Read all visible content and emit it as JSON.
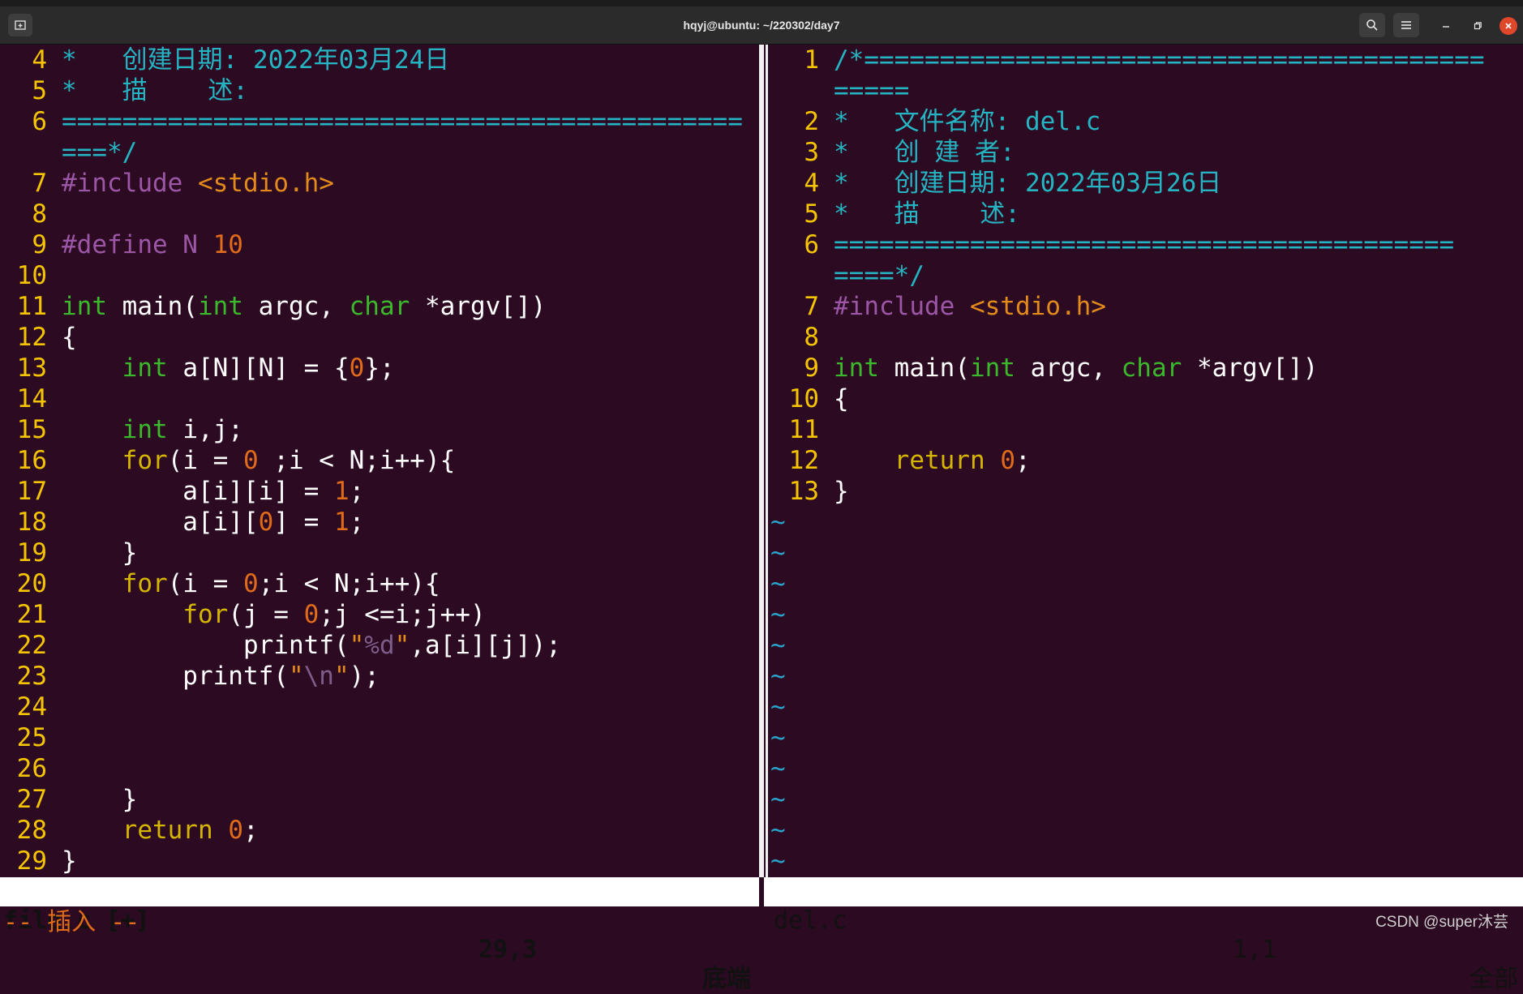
{
  "window": {
    "title": "hqyj@ubuntu: ~/220302/day7",
    "new_tab_icon": "new-tab-icon",
    "search_icon": "search-icon",
    "menu_icon": "hamburger-menu-icon",
    "minimize_icon": "minimize-icon",
    "maximize_icon": "maximize-icon",
    "close_icon": "close-icon"
  },
  "left_pane": {
    "lines": [
      {
        "n": "4",
        "segs": [
          {
            "t": "*   创建日期: 2022年03月24日",
            "c": "cmt"
          }
        ]
      },
      {
        "n": "5",
        "segs": [
          {
            "t": "*   描    述:",
            "c": "cmt"
          }
        ]
      },
      {
        "n": "6",
        "segs": [
          {
            "t": "=============================================",
            "c": "cmt"
          }
        ]
      },
      {
        "n": "",
        "segs": [
          {
            "t": "===*/",
            "c": "cmt"
          }
        ]
      },
      {
        "n": "7",
        "segs": [
          {
            "t": "#include ",
            "c": "pre"
          },
          {
            "t": "<stdio.h>",
            "c": "str"
          }
        ]
      },
      {
        "n": "8",
        "segs": []
      },
      {
        "n": "9",
        "segs": [
          {
            "t": "#define N ",
            "c": "pre"
          },
          {
            "t": "10",
            "c": "num"
          }
        ]
      },
      {
        "n": "10",
        "segs": []
      },
      {
        "n": "11",
        "segs": [
          {
            "t": "int",
            "c": "typ"
          },
          {
            "t": " main(",
            "c": ""
          },
          {
            "t": "int",
            "c": "typ"
          },
          {
            "t": " argc, ",
            "c": ""
          },
          {
            "t": "char",
            "c": "typ"
          },
          {
            "t": " *argv[])",
            "c": ""
          }
        ]
      },
      {
        "n": "12",
        "segs": [
          {
            "t": "{",
            "c": ""
          }
        ]
      },
      {
        "n": "13",
        "segs": [
          {
            "t": "    ",
            "c": ""
          },
          {
            "t": "int",
            "c": "typ"
          },
          {
            "t": " a[N][N] = {",
            "c": ""
          },
          {
            "t": "0",
            "c": "num"
          },
          {
            "t": "};",
            "c": ""
          }
        ]
      },
      {
        "n": "14",
        "segs": []
      },
      {
        "n": "15",
        "segs": [
          {
            "t": "    ",
            "c": ""
          },
          {
            "t": "int",
            "c": "typ"
          },
          {
            "t": " i,j;",
            "c": ""
          }
        ]
      },
      {
        "n": "16",
        "segs": [
          {
            "t": "    ",
            "c": ""
          },
          {
            "t": "for",
            "c": "kw"
          },
          {
            "t": "(i = ",
            "c": ""
          },
          {
            "t": "0",
            "c": "num"
          },
          {
            "t": " ;i < N;i++){",
            "c": ""
          }
        ]
      },
      {
        "n": "17",
        "segs": [
          {
            "t": "        a[i][i] = ",
            "c": ""
          },
          {
            "t": "1",
            "c": "num"
          },
          {
            "t": ";",
            "c": ""
          }
        ]
      },
      {
        "n": "18",
        "segs": [
          {
            "t": "        a[i][",
            "c": ""
          },
          {
            "t": "0",
            "c": "num"
          },
          {
            "t": "] = ",
            "c": ""
          },
          {
            "t": "1",
            "c": "num"
          },
          {
            "t": ";",
            "c": ""
          }
        ]
      },
      {
        "n": "19",
        "segs": [
          {
            "t": "    }",
            "c": ""
          }
        ]
      },
      {
        "n": "20",
        "segs": [
          {
            "t": "    ",
            "c": ""
          },
          {
            "t": "for",
            "c": "kw"
          },
          {
            "t": "(i = ",
            "c": ""
          },
          {
            "t": "0",
            "c": "num"
          },
          {
            "t": ";i < N;i++){",
            "c": ""
          }
        ]
      },
      {
        "n": "21",
        "segs": [
          {
            "t": "        ",
            "c": ""
          },
          {
            "t": "for",
            "c": "kw"
          },
          {
            "t": "(j = ",
            "c": ""
          },
          {
            "t": "0",
            "c": "num"
          },
          {
            "t": ";j <=i;j++)",
            "c": ""
          }
        ]
      },
      {
        "n": "22",
        "segs": [
          {
            "t": "            printf(",
            "c": ""
          },
          {
            "t": "\"",
            "c": "str"
          },
          {
            "t": "%d",
            "c": "esc"
          },
          {
            "t": "\"",
            "c": "str"
          },
          {
            "t": ",a[i][j]);",
            "c": ""
          }
        ]
      },
      {
        "n": "23",
        "segs": [
          {
            "t": "        printf(",
            "c": ""
          },
          {
            "t": "\"",
            "c": "str"
          },
          {
            "t": "\\n",
            "c": "esc"
          },
          {
            "t": "\"",
            "c": "str"
          },
          {
            "t": ");",
            "c": ""
          }
        ]
      },
      {
        "n": "24",
        "segs": []
      },
      {
        "n": "25",
        "segs": []
      },
      {
        "n": "26",
        "segs": []
      },
      {
        "n": "27",
        "segs": [
          {
            "t": "    }",
            "c": ""
          }
        ]
      },
      {
        "n": "28",
        "segs": [
          {
            "t": "    ",
            "c": ""
          },
          {
            "t": "return",
            "c": "kw"
          },
          {
            "t": " ",
            "c": ""
          },
          {
            "t": "0",
            "c": "num"
          },
          {
            "t": ";",
            "c": ""
          }
        ]
      },
      {
        "n": "29",
        "segs": [
          {
            "t": "}",
            "c": ""
          }
        ]
      }
    ],
    "status": {
      "filename": "file.c [+]",
      "position": "29,3",
      "where": "底端"
    }
  },
  "right_pane": {
    "lines": [
      {
        "n": "1",
        "segs": [
          {
            "t": "/*=========================================",
            "c": "cmt"
          }
        ]
      },
      {
        "n": "",
        "segs": [
          {
            "t": "=====",
            "c": "cmt"
          }
        ]
      },
      {
        "n": "2",
        "segs": [
          {
            "t": "*   文件名称: del.c",
            "c": "cmt"
          }
        ]
      },
      {
        "n": "3",
        "segs": [
          {
            "t": "*   创 建 者:",
            "c": "cmt"
          }
        ]
      },
      {
        "n": "4",
        "segs": [
          {
            "t": "*   创建日期: 2022年03月26日",
            "c": "cmt"
          }
        ]
      },
      {
        "n": "5",
        "segs": [
          {
            "t": "*   描    述:",
            "c": "cmt"
          }
        ]
      },
      {
        "n": "6",
        "segs": [
          {
            "t": "=========================================",
            "c": "cmt"
          }
        ]
      },
      {
        "n": "",
        "segs": [
          {
            "t": "====*/",
            "c": "cmt"
          }
        ]
      },
      {
        "n": "7",
        "segs": [
          {
            "t": "#include ",
            "c": "pre"
          },
          {
            "t": "<stdio.h>",
            "c": "str"
          }
        ]
      },
      {
        "n": "8",
        "segs": []
      },
      {
        "n": "9",
        "segs": [
          {
            "t": "int",
            "c": "typ"
          },
          {
            "t": " main(",
            "c": ""
          },
          {
            "t": "int",
            "c": "typ"
          },
          {
            "t": " argc, ",
            "c": ""
          },
          {
            "t": "char",
            "c": "typ"
          },
          {
            "t": " *argv[])",
            "c": ""
          }
        ]
      },
      {
        "n": "10",
        "segs": [
          {
            "t": "{",
            "c": ""
          }
        ]
      },
      {
        "n": "11",
        "segs": []
      },
      {
        "n": "12",
        "segs": [
          {
            "t": "    ",
            "c": ""
          },
          {
            "t": "return",
            "c": "kw"
          },
          {
            "t": " ",
            "c": ""
          },
          {
            "t": "0",
            "c": "num"
          },
          {
            "t": ";",
            "c": ""
          }
        ]
      },
      {
        "n": "13",
        "segs": [
          {
            "t": "}",
            "c": ""
          }
        ]
      }
    ],
    "tildes": [
      "~",
      "~",
      "~",
      "~",
      "~",
      "~",
      "~",
      "~",
      "~",
      "~",
      "~",
      "~"
    ],
    "status": {
      "filename": "del.c",
      "position": "1,1",
      "where": "全部"
    }
  },
  "mode_line": "-- 插入 --",
  "watermark": "CSDN @super沐芸",
  "colors": {
    "background": "#2c0a22",
    "line_number": "#f5c400",
    "comment": "#25b5c2",
    "preprocessor": "#9b57a6",
    "string": "#e38a1c",
    "type": "#3cb82c",
    "keyword": "#d4b500",
    "number": "#e06b1a",
    "tilde": "#2aa3cc"
  }
}
